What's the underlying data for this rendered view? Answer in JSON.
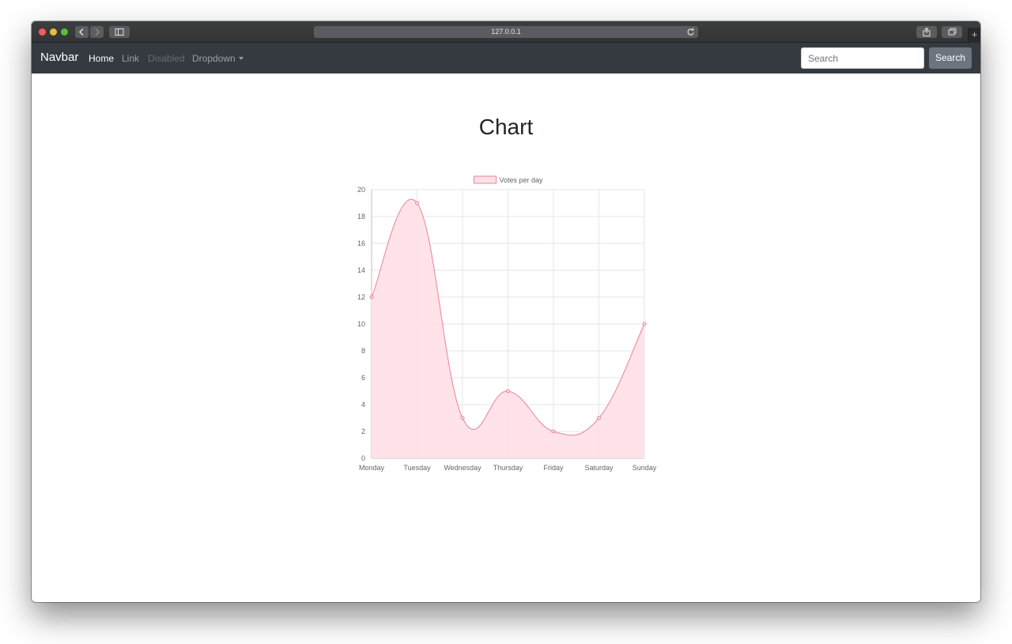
{
  "browser": {
    "url": "127.0.0.1",
    "new_tab_label": "+"
  },
  "navbar": {
    "brand": "Navbar",
    "links": [
      {
        "label": "Home",
        "state": "active"
      },
      {
        "label": "Link",
        "state": "normal"
      },
      {
        "label": "Disabled",
        "state": "disabled"
      },
      {
        "label": "Dropdown",
        "state": "dropdown"
      }
    ],
    "search": {
      "placeholder": "Search",
      "value": ""
    },
    "search_button": "Search"
  },
  "page": {
    "title": "Chart"
  },
  "colors": {
    "navbar_bg": "#343a40",
    "series_line": "#e8839a",
    "series_fill": "#ffe0e6",
    "search_button_bg": "#6c757d"
  },
  "icons": [
    "back-chevron-icon",
    "forward-chevron-icon",
    "sidebar-icon",
    "reload-icon",
    "share-icon",
    "tabs-icon"
  ],
  "chart_data": {
    "type": "line",
    "smooth": true,
    "filled": true,
    "categories": [
      "Monday",
      "Tuesday",
      "Wednesday",
      "Thursday",
      "Friday",
      "Saturday",
      "Sunday"
    ],
    "series": [
      {
        "name": "Votes per day",
        "values": [
          12,
          19,
          3,
          5,
          2,
          3,
          10
        ]
      }
    ],
    "ylim": [
      0,
      20
    ],
    "yticks": [
      0,
      2,
      4,
      6,
      8,
      10,
      12,
      14,
      16,
      18,
      20
    ],
    "grid": true,
    "legend": "top-center"
  }
}
